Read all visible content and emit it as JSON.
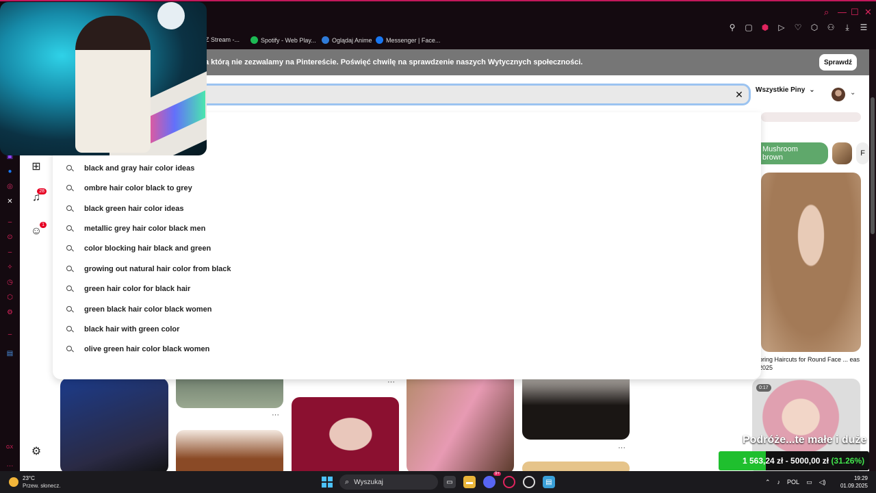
{
  "browser": {
    "bookmarks": [
      {
        "label": "Z Stream -...",
        "color": "#7a7a7a"
      },
      {
        "label": "Spotify - Web Play...",
        "color": "#1db954"
      },
      {
        "label": "Oglądaj Anime",
        "color": "#2f7bd8"
      },
      {
        "label": "Messenger | Face...",
        "color": "#1877f2"
      }
    ]
  },
  "banner": {
    "text": "a którą nie zezwalamy na Pintereście. Poświęć chwilę na sprawdzenie naszych Wytycznych społeczności.",
    "button": "Sprawdź"
  },
  "topbar": {
    "search_value": "",
    "clear_icon": "close-icon",
    "filter_label": "Wszystkie Piny"
  },
  "sidebar_badges": {
    "notifications": "28",
    "messages": "1"
  },
  "suggestions": [
    "black and gray hair color ideas",
    "ombre hair color black to grey",
    "black green hair color ideas",
    "metallic grey hair color black men",
    "color blocking hair black and green",
    "growing out natural hair color from black",
    "green hair color for black hair",
    "green black hair color black women",
    "black hair with green color",
    "olive green hair color black women"
  ],
  "chips": {
    "mushroom": "Mushroom brown",
    "partial": "F"
  },
  "pin_caption": "pring Haircuts for Round Face ... eas 2025",
  "video_time": "0:17",
  "pin_more_label": "···",
  "overlay": {
    "title": "Podróże...te małe i duże",
    "price": "1 563,24 zł  -  5000,00 zł",
    "percent": "(31.26%)",
    "progress_fraction": 0.3126
  },
  "taskbar": {
    "temp": "23°C",
    "weather": "Przew. słonecz.",
    "search": "Wyszukaj",
    "lang": "POL",
    "time": "19:29",
    "date": "01.09.2025",
    "discord_badge": "9+"
  },
  "corner_badge": "GX",
  "colors": {
    "accent": "#e0245e",
    "pinterest_red": "#e60023",
    "search_focus": "#9bc3f0"
  }
}
